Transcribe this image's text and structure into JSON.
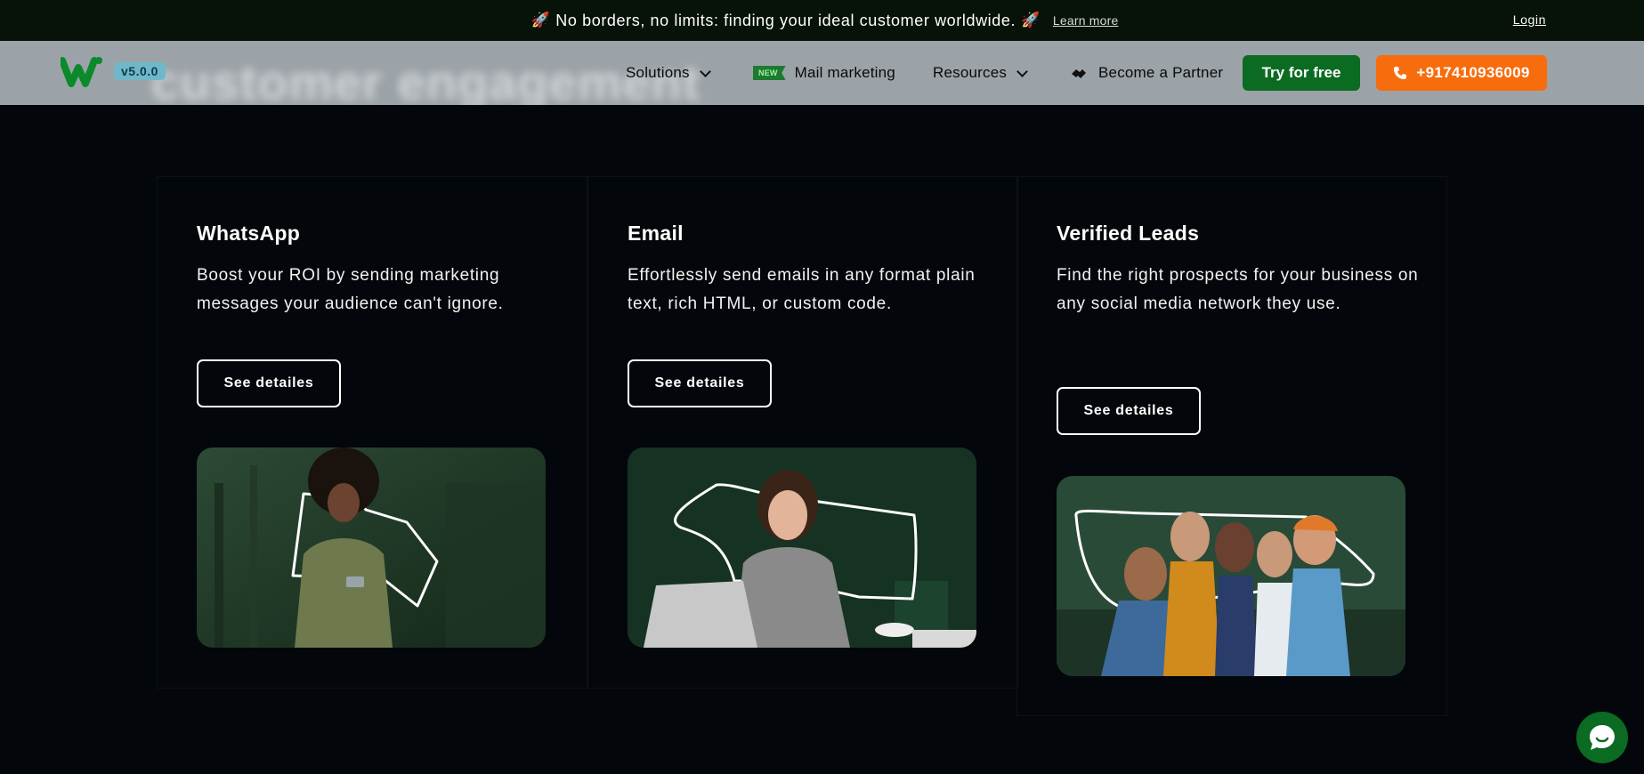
{
  "announcement": {
    "text": "No borders, no limits: finding your ideal customer worldwide.",
    "learn_more": "Learn more",
    "login": "Login"
  },
  "header": {
    "ghost_heading": "customer engagement",
    "version": "v5.0.0",
    "nav": {
      "solutions": "Solutions",
      "new_tag": "NEW",
      "mail_marketing": "Mail marketing",
      "resources": "Resources",
      "partner": "Become a Partner"
    },
    "try_free": "Try for free",
    "phone": "+917410936009"
  },
  "cards": [
    {
      "title": "WhatsApp",
      "description": "Boost your ROI by sending marketing messages your audience can't ignore.",
      "button": "See detailes"
    },
    {
      "title": "Email",
      "description": "Effortlessly send emails in any format plain text, rich HTML, or custom code.",
      "button": "See detailes"
    },
    {
      "title": "Verified Leads",
      "description": "Find the right prospects for your business on any social media network they use.",
      "button": "See detailes"
    }
  ],
  "colors": {
    "brand_green": "#0b6b22",
    "phone_orange": "#f76c0c",
    "page_bg": "#03060a",
    "nav_bg": "#9ca3a8"
  },
  "icons": {
    "announcement": "rocket-icon",
    "logo": "logo-icon",
    "partner": "handshake-icon",
    "phone": "phone-icon",
    "chat": "chat-icon"
  }
}
